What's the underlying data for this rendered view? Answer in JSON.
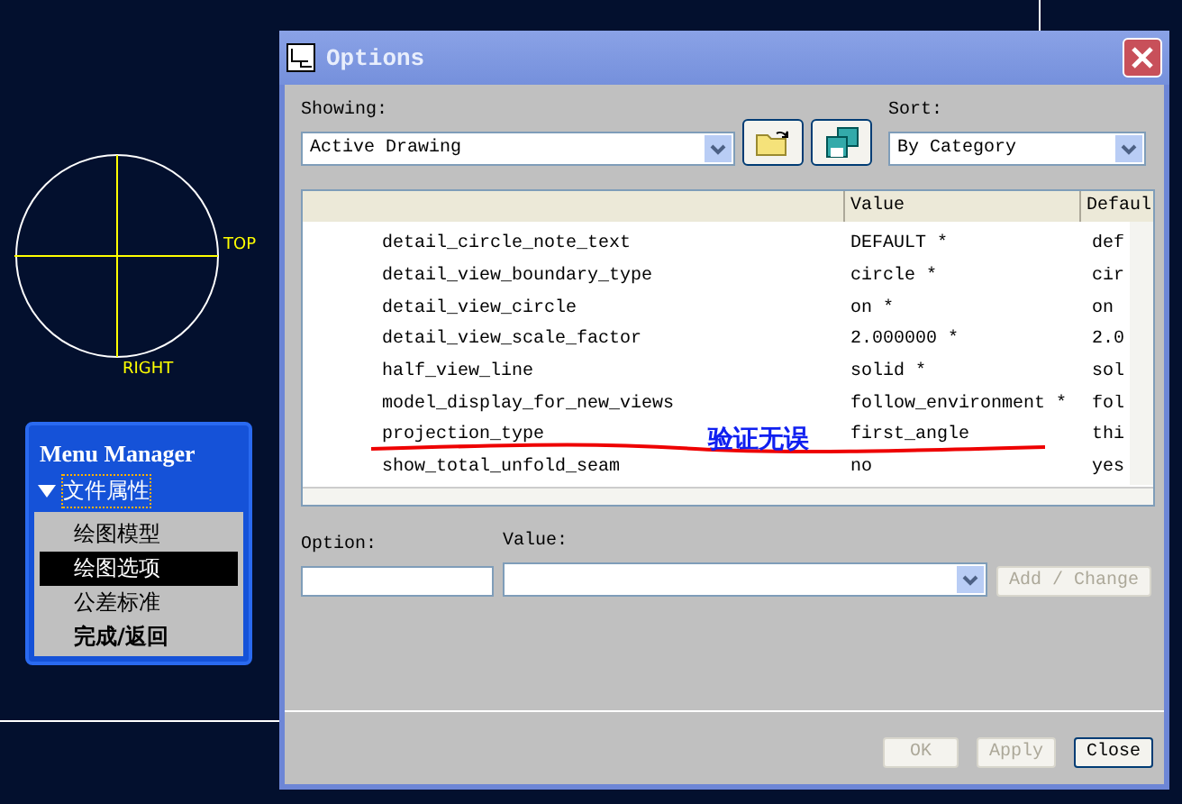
{
  "drawing": {
    "labels": [
      "TOP",
      "RIGHT"
    ]
  },
  "menu_manager": {
    "title": "Menu Manager",
    "section": {
      "label": "文件属性",
      "expanded": true
    },
    "items": [
      {
        "label": "绘图模型",
        "selected": false,
        "bold": false
      },
      {
        "label": "绘图选项",
        "selected": true,
        "bold": false
      },
      {
        "label": "公差标准",
        "selected": false,
        "bold": false
      },
      {
        "label": "完成/返回",
        "selected": false,
        "bold": true
      }
    ]
  },
  "dialog": {
    "title": "Options",
    "showing_label": "Showing:",
    "showing_value": "Active Drawing",
    "sort_label": "Sort:",
    "sort_value": "By Category",
    "table": {
      "columns": [
        "Value",
        "Defaul"
      ],
      "rows": [
        {
          "name": "detail_circle_note_text",
          "value": "DEFAULT *",
          "default": "def"
        },
        {
          "name": "detail_view_boundary_type",
          "value": "circle *",
          "default": "cir"
        },
        {
          "name": "detail_view_circle",
          "value": "on *",
          "default": "on"
        },
        {
          "name": "detail_view_scale_factor",
          "value": "2.000000 *",
          "default": "2.0"
        },
        {
          "name": "half_view_line",
          "value": "solid *",
          "default": "sol"
        },
        {
          "name": "model_display_for_new_views",
          "value": "follow_environment *",
          "default": "fol"
        },
        {
          "name": "projection_type",
          "value": "first_angle",
          "default": "thi"
        },
        {
          "name": "show_total_unfold_seam",
          "value": "no",
          "default": "yes"
        }
      ]
    },
    "annotation": "验证无误",
    "option_label": "Option:",
    "value_label": "Value:",
    "buttons": [
      {
        "label": "Add / Change",
        "disabled": true
      },
      {
        "label": "OK",
        "disabled": true
      },
      {
        "label": "Apply",
        "disabled": true
      },
      {
        "label": "Close",
        "disabled": false
      }
    ]
  }
}
